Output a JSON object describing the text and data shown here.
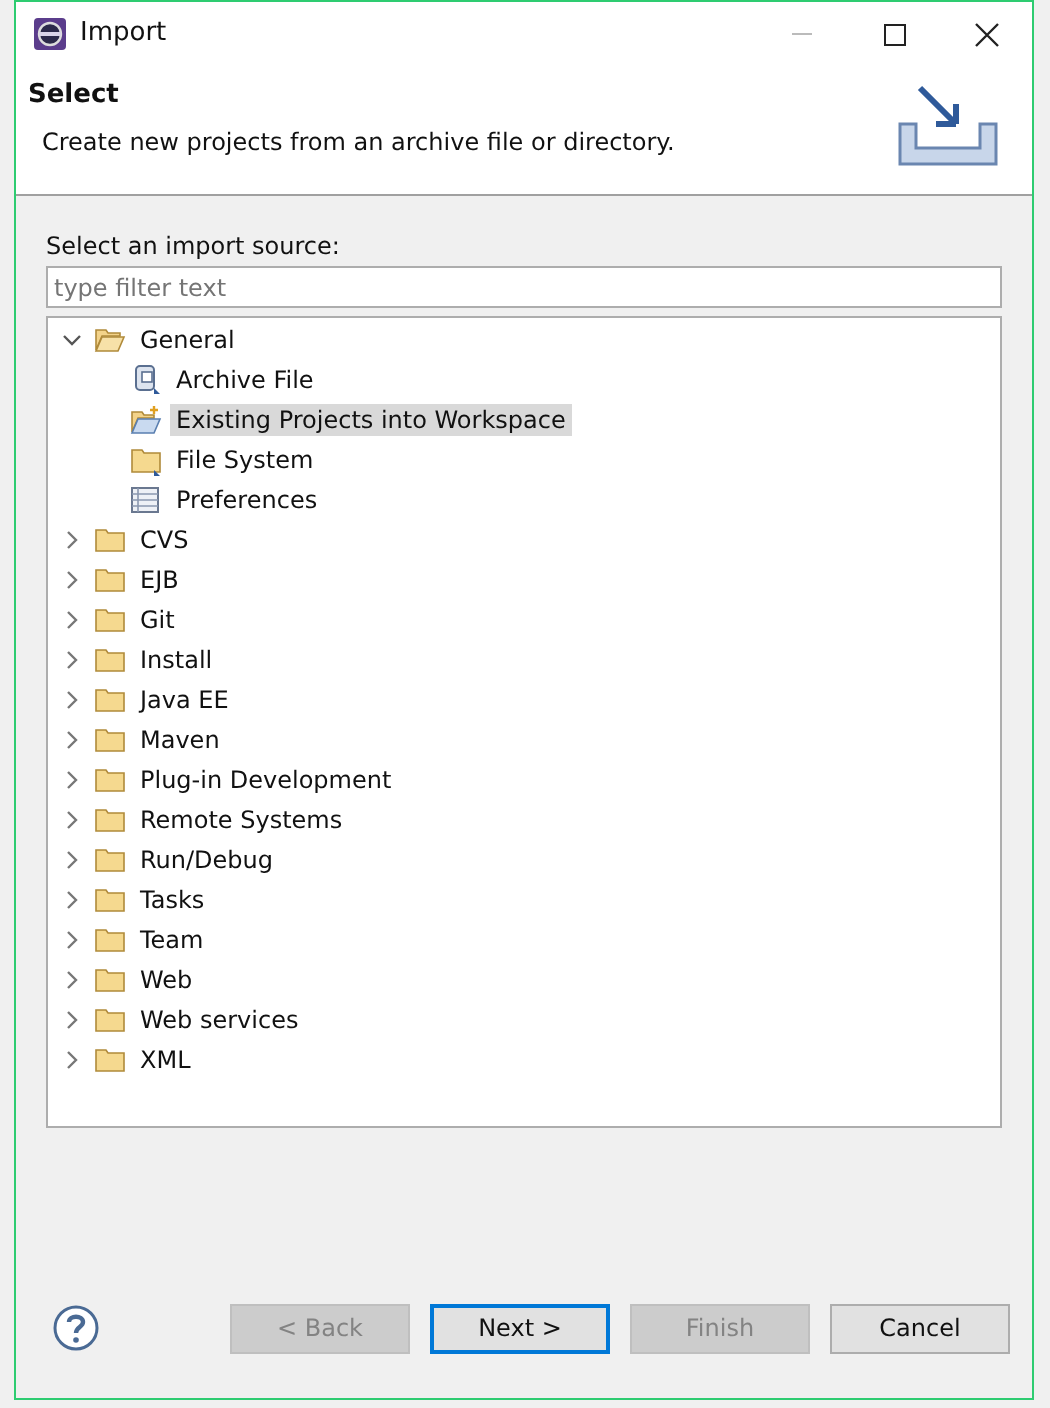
{
  "window": {
    "title": "Import"
  },
  "header": {
    "title": "Select",
    "description": "Create new projects from an archive file or directory."
  },
  "source_label": "Select an import source:",
  "filter": {
    "placeholder": "type filter text"
  },
  "tree": [
    {
      "label": "General",
      "expanded": true,
      "selected": false,
      "children": [
        {
          "label": "Archive File",
          "kind": "archive",
          "selected": false
        },
        {
          "label": "Existing Projects into Workspace",
          "kind": "projects",
          "selected": true
        },
        {
          "label": "File System",
          "kind": "folder",
          "selected": false
        },
        {
          "label": "Preferences",
          "kind": "preferences",
          "selected": false
        }
      ]
    },
    {
      "label": "CVS",
      "expanded": false,
      "selected": false
    },
    {
      "label": "EJB",
      "expanded": false,
      "selected": false
    },
    {
      "label": "Git",
      "expanded": false,
      "selected": false
    },
    {
      "label": "Install",
      "expanded": false,
      "selected": false
    },
    {
      "label": "Java EE",
      "expanded": false,
      "selected": false
    },
    {
      "label": "Maven",
      "expanded": false,
      "selected": false
    },
    {
      "label": "Plug-in Development",
      "expanded": false,
      "selected": false
    },
    {
      "label": "Remote Systems",
      "expanded": false,
      "selected": false
    },
    {
      "label": "Run/Debug",
      "expanded": false,
      "selected": false
    },
    {
      "label": "Tasks",
      "expanded": false,
      "selected": false
    },
    {
      "label": "Team",
      "expanded": false,
      "selected": false
    },
    {
      "label": "Web",
      "expanded": false,
      "selected": false
    },
    {
      "label": "Web services",
      "expanded": false,
      "selected": false
    },
    {
      "label": "XML",
      "expanded": false,
      "selected": false
    }
  ],
  "buttons": [
    {
      "label": "< Back",
      "disabled": true,
      "default": false
    },
    {
      "label": "Next >",
      "disabled": false,
      "default": true
    },
    {
      "label": "Finish",
      "disabled": true,
      "default": false
    },
    {
      "label": "Cancel",
      "disabled": false,
      "default": false
    }
  ]
}
